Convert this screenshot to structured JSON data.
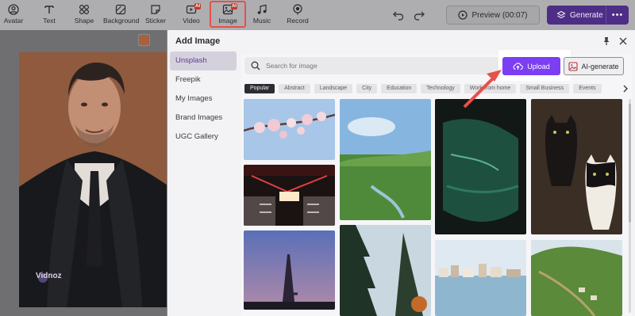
{
  "toolbar": {
    "items": [
      {
        "label": "Avatar",
        "icon": "avatar-icon"
      },
      {
        "label": "Text",
        "icon": "text-icon"
      },
      {
        "label": "Shape",
        "icon": "shape-icon"
      },
      {
        "label": "Background",
        "icon": "background-icon"
      },
      {
        "label": "Sticker",
        "icon": "sticker-icon"
      },
      {
        "label": "Video",
        "icon": "video-icon",
        "badge": "AI"
      },
      {
        "label": "Image",
        "icon": "image-icon",
        "badge": "AI"
      },
      {
        "label": "Music",
        "icon": "music-icon"
      },
      {
        "label": "Record",
        "icon": "record-icon"
      }
    ],
    "preview_label": "Preview (00:07)",
    "generate_label": "Generate",
    "more_label": "•••"
  },
  "canvas": {
    "swatch_color": "#a6613d",
    "watermark": "Vidnoz"
  },
  "panel": {
    "title": "Add Image",
    "nav": [
      "Unsplash",
      "Freepik",
      "My Images",
      "Brand Images",
      "UGC Gallery"
    ],
    "active_nav": "Unsplash",
    "search_placeholder": "Search for image",
    "upload_label": "Upload",
    "aigen_label": "AI-generate",
    "chips": [
      "Popular",
      "Abstract",
      "Landscape",
      "City",
      "Education",
      "Technology",
      "Work from home",
      "Small Business",
      "Events"
    ],
    "active_chip": "Popular"
  },
  "colors": {
    "accent": "#7b3ef2",
    "highlight": "#e8504a"
  }
}
